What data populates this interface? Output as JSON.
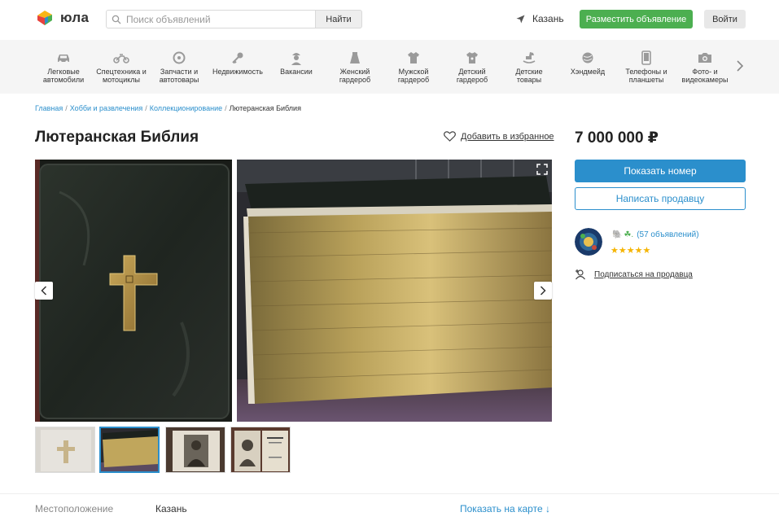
{
  "header": {
    "logo_text": "юла",
    "search_placeholder": "Поиск объявлений",
    "search_button": "Найти",
    "city": "Казань",
    "post_button": "Разместить объявление",
    "login_button": "Войти"
  },
  "categories": [
    {
      "label": "Легковые\nавтомобили",
      "icon": "car-icon"
    },
    {
      "label": "Спецтехника и\nмотоциклы",
      "icon": "motorcycle-icon"
    },
    {
      "label": "Запчасти и\nавтотовары",
      "icon": "wheel-icon"
    },
    {
      "label": "Недвижимость",
      "icon": "key-icon"
    },
    {
      "label": "Вакансии",
      "icon": "worker-icon"
    },
    {
      "label": "Женский\nгардероб",
      "icon": "skirt-icon"
    },
    {
      "label": "Мужской\nгардероб",
      "icon": "shirt-icon"
    },
    {
      "label": "Детский\nгардероб",
      "icon": "kid-shirt-icon"
    },
    {
      "label": "Детские\nтовары",
      "icon": "rocking-horse-icon"
    },
    {
      "label": "Хэндмейд",
      "icon": "yarn-icon"
    },
    {
      "label": "Телефоны и\nпланшеты",
      "icon": "phone-icon"
    },
    {
      "label": "Фото- и\nвидеокамеры",
      "icon": "camera-icon"
    }
  ],
  "breadcrumb": {
    "items": [
      "Главная",
      "Хобби и развлечения",
      "Коллекционирование"
    ],
    "current": "Лютеранская Библия"
  },
  "listing": {
    "title": "Лютеранская Библия",
    "favorite_label": "Добавить в избранное",
    "price": "7 000 000 ₽"
  },
  "actions": {
    "show_number": "Показать номер",
    "write_seller": "Написать продавцу"
  },
  "seller": {
    "listings": "(57 объявлений)",
    "rating": "★★★★★",
    "subscribe": "Подписаться на продавца"
  },
  "location": {
    "label": "Местоположение",
    "value": "Казань",
    "map_link": "Показать на карте ↓"
  },
  "colors": {
    "accent": "#2b8fcc",
    "post_green": "#4caf50",
    "star": "#f5b400"
  }
}
